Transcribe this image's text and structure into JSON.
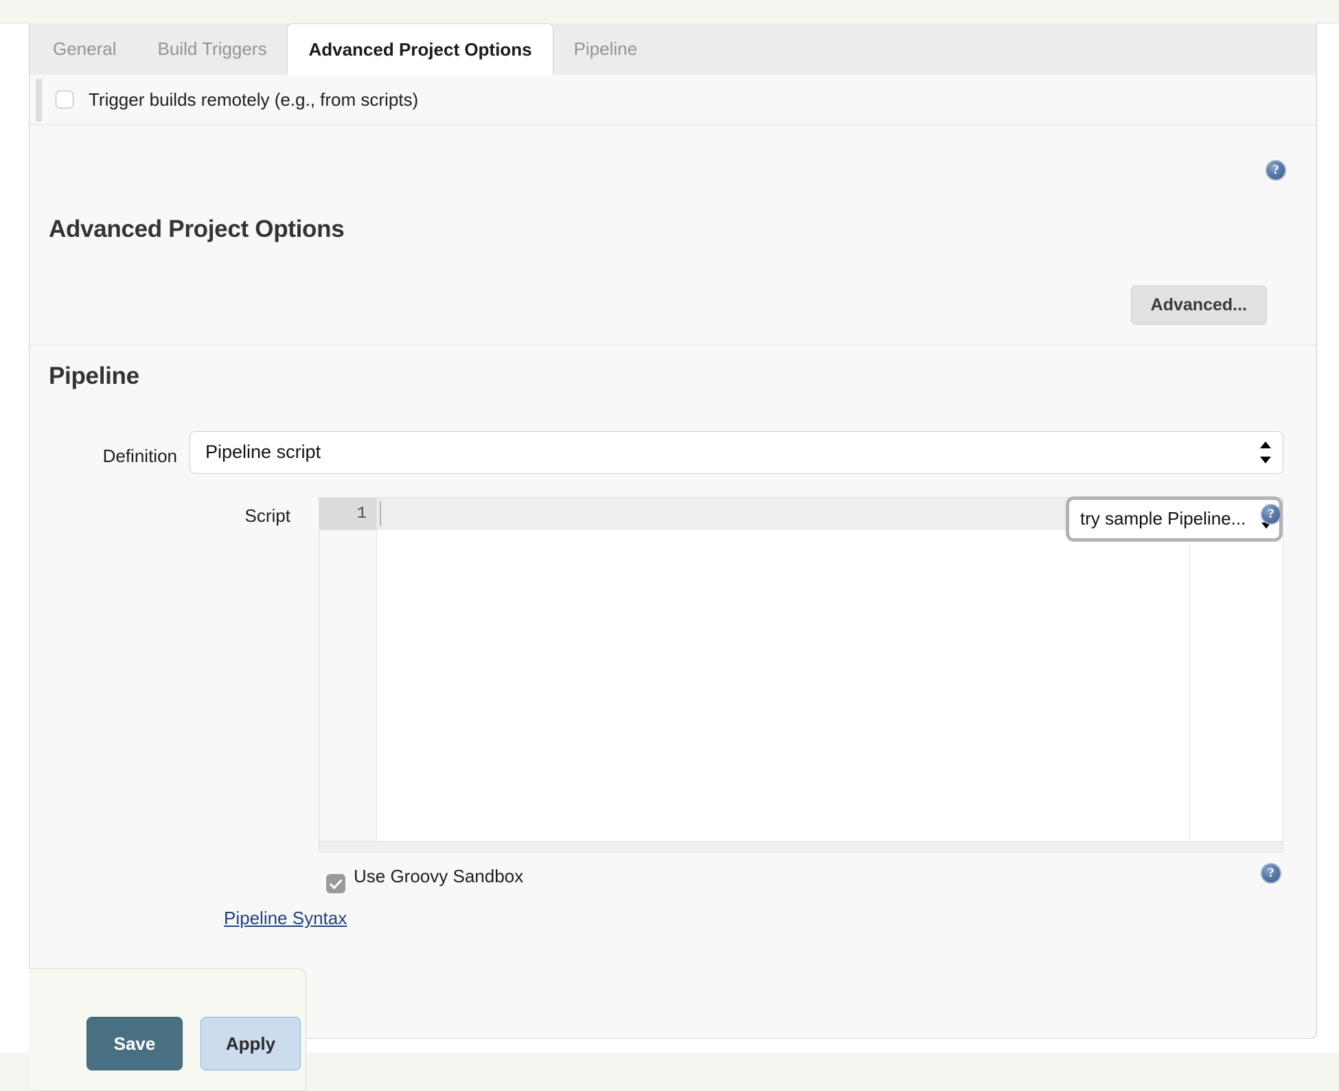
{
  "tabs": [
    {
      "label": "General",
      "active": false
    },
    {
      "label": "Build Triggers",
      "active": false
    },
    {
      "label": "Advanced Project Options",
      "active": true
    },
    {
      "label": "Pipeline",
      "active": false
    }
  ],
  "trigger": {
    "label": "Trigger builds remotely (e.g., from scripts)",
    "checked": false
  },
  "advanced_project_options": {
    "heading": "Advanced Project Options",
    "advanced_button": "Advanced..."
  },
  "pipeline": {
    "heading": "Pipeline",
    "definition": {
      "label": "Definition",
      "value": "Pipeline script"
    },
    "script": {
      "label": "Script",
      "line_number": "1",
      "content": "",
      "sample_select_value": "try sample Pipeline..."
    },
    "sandbox": {
      "label": "Use Groovy Sandbox",
      "checked": true
    },
    "syntax_link": "Pipeline Syntax"
  },
  "footer": {
    "save_label": "Save",
    "apply_label": "Apply"
  },
  "icons": {
    "help": "?"
  },
  "colors": {
    "save_bg": "#486f82",
    "apply_bg": "#ccdcef",
    "link": "#23417a",
    "help_icon": "#5b7aaa",
    "active_tab_bg": "#ffffff",
    "tab_bar_bg": "#ececec"
  }
}
